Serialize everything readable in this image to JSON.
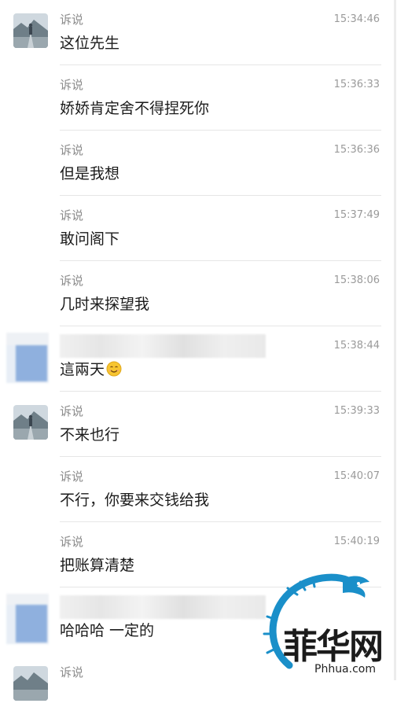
{
  "messages": [
    {
      "sender": "诉说",
      "time": "15:34:46",
      "text": "这位先生",
      "avatar": "photo"
    },
    {
      "sender": "诉说",
      "time": "15:36:33",
      "text": "娇娇肯定舍不得捏死你",
      "avatar": "none"
    },
    {
      "sender": "诉说",
      "time": "15:36:36",
      "text": "但是我想",
      "avatar": "none"
    },
    {
      "sender": "诉说",
      "time": "15:37:49",
      "text": "敢问阁下",
      "avatar": "none"
    },
    {
      "sender": "诉说",
      "time": "15:38:06",
      "text": "几时来探望我",
      "avatar": "none"
    },
    {
      "sender": "",
      "time": "15:38:44",
      "text": "這兩天",
      "avatar": "blurred",
      "emoji": "smiley-emoji"
    },
    {
      "sender": "诉说",
      "time": "15:39:33",
      "text": "不来也行",
      "avatar": "photo"
    },
    {
      "sender": "诉说",
      "time": "15:40:07",
      "text": "不行，你要来交钱给我",
      "avatar": "none"
    },
    {
      "sender": "诉说",
      "time": "15:40:19",
      "text": "把账算清楚",
      "avatar": "none"
    },
    {
      "sender": "",
      "time": "",
      "text": "哈哈哈 一定的",
      "avatar": "blurred"
    },
    {
      "sender": "诉说",
      "time": "",
      "text": "",
      "avatar": "photo"
    }
  ],
  "watermark": {
    "brand": "菲华网",
    "domain": "Phhua.com"
  },
  "colors": {
    "background": "#ffffff",
    "divider": "#e6e6e6",
    "name": "#8c8c8c",
    "text": "#1b1b1b"
  }
}
